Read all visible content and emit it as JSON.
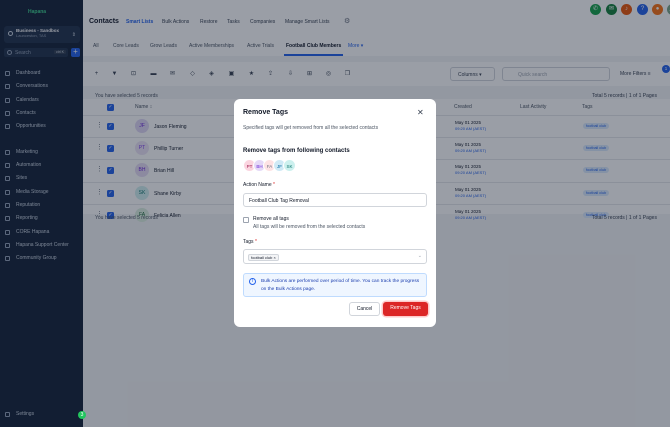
{
  "app": {
    "logo_text": "Hapana"
  },
  "sidebar": {
    "account_name": "Business - Sandbox",
    "account_location": "Launceston, TAS",
    "search_placeholder": "Search",
    "search_shortcut": "ctrl K",
    "add_label": "+",
    "items": [
      {
        "label": "Dashboard"
      },
      {
        "label": "Conversations"
      },
      {
        "label": "Calendars"
      },
      {
        "label": "Contacts"
      },
      {
        "label": "Opportunities"
      },
      {
        "label": "Marketing"
      },
      {
        "label": "Automation"
      },
      {
        "label": "Sites"
      },
      {
        "label": "Media Storage"
      },
      {
        "label": "Reputation"
      },
      {
        "label": "Reporting"
      },
      {
        "label": "CORE Hapana"
      },
      {
        "label": "Hapana Support Center"
      },
      {
        "label": "Community Group"
      }
    ],
    "settings_label": "Settings",
    "settings_dot": "3"
  },
  "header": {
    "title": "Contacts",
    "tabs": [
      "Smart Lists",
      "Bulk Actions",
      "Restore",
      "Tasks",
      "Companies",
      "Manage Smart Lists"
    ]
  },
  "subtabs": [
    "All",
    "Core Leads",
    "Grow Leads",
    "Active Memberships",
    "Active Trials",
    "Football Club Members",
    "More"
  ],
  "toolbar": {
    "columns_label": "Columns",
    "search_placeholder": "Quick search",
    "more_filters_label": "More Filters",
    "filter_count": "1"
  },
  "selection_info": "You have selected 5 records",
  "pagination_info": "Total 5 records | 1 of 1 Pages",
  "table": {
    "headers": [
      "Name",
      "Created",
      "Last Activity",
      "Tags"
    ],
    "rows": [
      {
        "initials": "JF",
        "name": "Jason Fleming",
        "date": "May 01 2025",
        "time": "09:20 AM (AEST)",
        "tag": "football club",
        "avatar_bg": "#e0d7f5",
        "avatar_fg": "#6d28d9"
      },
      {
        "initials": "PT",
        "name": "Phillip Turner",
        "date": "May 01 2025",
        "time": "09:20 AM (AEST)",
        "tag": "football club",
        "avatar_bg": "#ede4f7",
        "avatar_fg": "#7c3aed"
      },
      {
        "initials": "BH",
        "name": "Brian Hill",
        "date": "May 01 2025",
        "time": "09:20 AM (AEST)",
        "tag": "football club",
        "avatar_bg": "#e7ddf5",
        "avatar_fg": "#6d28d9"
      },
      {
        "initials": "SK",
        "name": "Shane Kirby",
        "date": "May 01 2025",
        "time": "09:20 AM (AEST)",
        "tag": "football club",
        "avatar_bg": "#d1f0f0",
        "avatar_fg": "#0f766e"
      },
      {
        "initials": "FA",
        "name": "Felicia Allen",
        "date": "May 01 2025",
        "time": "09:20 AM (AEST)",
        "tag": "football club",
        "avatar_bg": "#dcefe1",
        "avatar_fg": "#166534"
      }
    ]
  },
  "modal": {
    "title": "Remove Tags",
    "description": "Specified tags will get removed from all the selected contacts",
    "contacts_heading": "Remove tags from following contacts",
    "avatars": [
      {
        "initials": "PT",
        "bg": "#fbd5e0",
        "fg": "#9d174d"
      },
      {
        "initials": "BH",
        "bg": "#e5d9f7",
        "fg": "#6d28d9"
      },
      {
        "initials": "FA",
        "bg": "#fde2e4",
        "fg": "#6b7280"
      },
      {
        "initials": "JF",
        "bg": "#cfe9f5",
        "fg": "#0369a1"
      },
      {
        "initials": "SK",
        "bg": "#ccf0ee",
        "fg": "#0f766e"
      }
    ],
    "action_name_label": "Action Name",
    "action_name_value": "Football Club Tag Removal",
    "remove_all_label": "Remove all tags",
    "remove_all_desc": "All tags will be removed from the selected contacts",
    "tags_label": "Tags",
    "selected_tag": "football club",
    "info_text": "Bulk Actions are performed over period of time. You can track the progress on the Bulk Actions page.",
    "cancel_label": "Cancel",
    "remove_label": "Remove Tags",
    "required_mark": "*"
  },
  "colors": {
    "accent": "#2563eb",
    "danger": "#dc2626",
    "sidebar": "#15233a",
    "brand": "#3ecf8e"
  }
}
